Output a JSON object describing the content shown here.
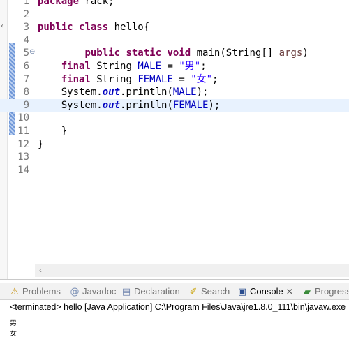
{
  "editor": {
    "lines": [
      {
        "num": "1",
        "tokens": [
          {
            "t": "package ",
            "c": "kw"
          },
          {
            "t": "rack;",
            "c": ""
          }
        ]
      },
      {
        "num": "2",
        "tokens": []
      },
      {
        "num": "3",
        "tokens": [
          {
            "t": "public ",
            "c": "kw"
          },
          {
            "t": "class ",
            "c": "kw"
          },
          {
            "t": "hello{",
            "c": ""
          }
        ]
      },
      {
        "num": "4",
        "tokens": []
      },
      {
        "num": "5",
        "fold": "⊖",
        "tokens": [
          {
            "t": "\t\t",
            "c": ""
          },
          {
            "t": "public ",
            "c": "kw"
          },
          {
            "t": "static ",
            "c": "kw"
          },
          {
            "t": "void ",
            "c": "kw"
          },
          {
            "t": "main(String[] ",
            "c": ""
          },
          {
            "t": "args",
            "c": "param"
          },
          {
            "t": ")",
            "c": ""
          }
        ]
      },
      {
        "num": "6",
        "tokens": [
          {
            "t": "\t",
            "c": ""
          },
          {
            "t": "final ",
            "c": "kw"
          },
          {
            "t": "String ",
            "c": ""
          },
          {
            "t": "MALE",
            "c": "field"
          },
          {
            "t": " = ",
            "c": ""
          },
          {
            "t": "\"男\"",
            "c": "str"
          },
          {
            "t": ";",
            "c": ""
          }
        ]
      },
      {
        "num": "7",
        "tokens": [
          {
            "t": "\t",
            "c": ""
          },
          {
            "t": "final ",
            "c": "kw"
          },
          {
            "t": "String ",
            "c": ""
          },
          {
            "t": "FEMALE",
            "c": "field"
          },
          {
            "t": " = ",
            "c": ""
          },
          {
            "t": "\"女\"",
            "c": "str"
          },
          {
            "t": ";",
            "c": ""
          }
        ]
      },
      {
        "num": "8",
        "tokens": [
          {
            "t": "\tSystem.",
            "c": ""
          },
          {
            "t": "out",
            "c": "sfield"
          },
          {
            "t": ".println(",
            "c": ""
          },
          {
            "t": "MALE",
            "c": "field"
          },
          {
            "t": ");",
            "c": ""
          }
        ]
      },
      {
        "num": "9",
        "current": true,
        "tokens": [
          {
            "t": "\tSystem.",
            "c": ""
          },
          {
            "t": "out",
            "c": "sfield"
          },
          {
            "t": ".println(",
            "c": ""
          },
          {
            "t": "FEMALE",
            "c": "field"
          },
          {
            "t": ");",
            "c": ""
          }
        ]
      },
      {
        "num": "10",
        "tokens": []
      },
      {
        "num": "11",
        "tokens": [
          {
            "t": "    }",
            "c": ""
          }
        ]
      },
      {
        "num": "12",
        "tokens": [
          {
            "t": "}",
            "c": ""
          }
        ]
      },
      {
        "num": "13",
        "tokens": []
      },
      {
        "num": "14",
        "tokens": []
      }
    ]
  },
  "panel": {
    "tabs": [
      {
        "label": "Problems",
        "icon": "problems-icon",
        "glyph": "⚠",
        "color": "#c28a00",
        "active": false
      },
      {
        "label": "Javadoc",
        "icon": "javadoc-icon",
        "glyph": "@",
        "color": "#7a8fb5",
        "active": false
      },
      {
        "label": "Declaration",
        "icon": "declaration-icon",
        "glyph": "▤",
        "color": "#6d82ac",
        "active": false
      },
      {
        "label": "Search",
        "icon": "search-icon",
        "glyph": "✐",
        "color": "#c8a000",
        "active": false
      },
      {
        "label": "Console",
        "icon": "console-icon",
        "glyph": "▣",
        "color": "#2a4d8f",
        "active": true
      },
      {
        "label": "Progress",
        "icon": "progress-icon",
        "glyph": "▰",
        "color": "#3b8b3b",
        "active": false
      }
    ],
    "close_glyph": "✕",
    "console": {
      "header": "<terminated> hello [Java Application] C:\\Program Files\\Java\\jre1.8.0_111\\bin\\javaw.exe",
      "output": [
        "男",
        "女"
      ]
    }
  },
  "colors": {
    "keyword": "#7f0055",
    "field": "#0000c0",
    "string": "#2a00ff",
    "current_line": "#e8f2fe"
  }
}
